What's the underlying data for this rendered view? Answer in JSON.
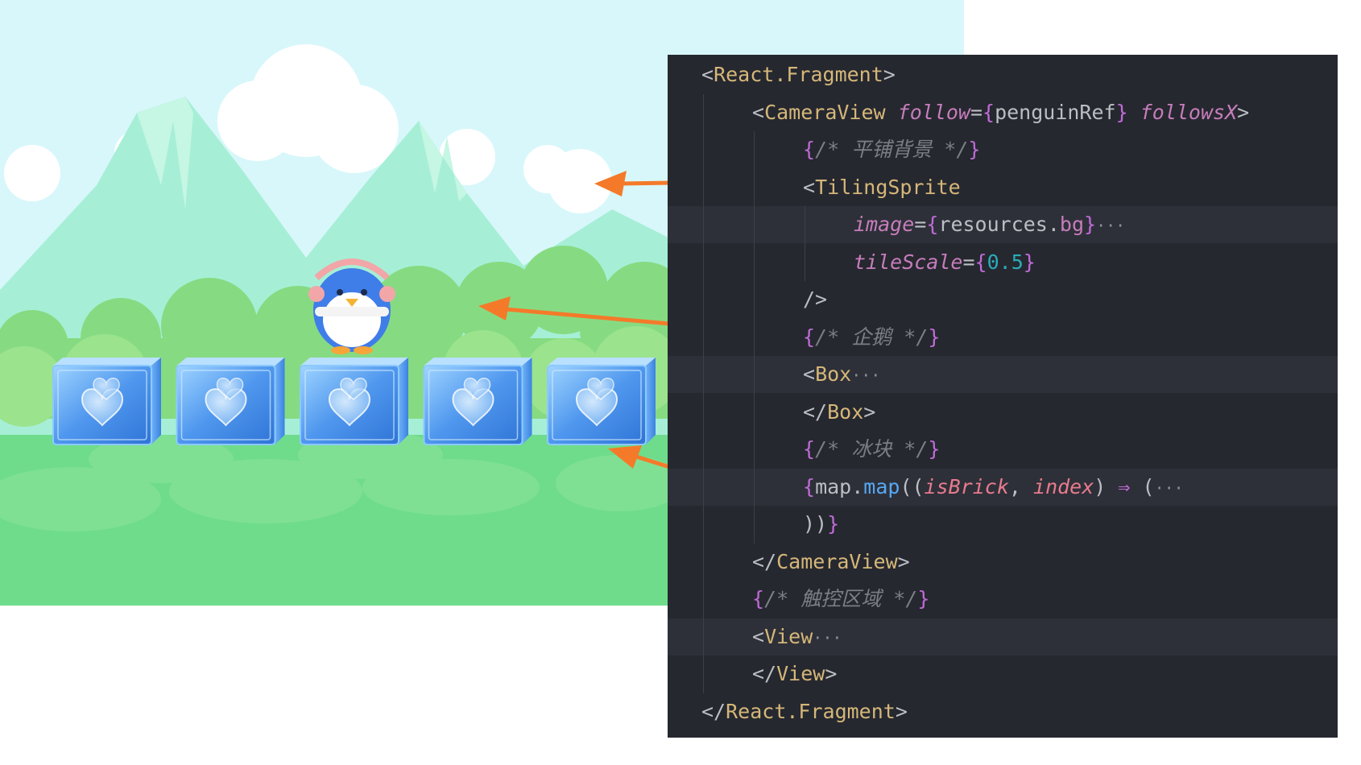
{
  "code": {
    "lines": [
      {
        "indent": 0,
        "hl": false,
        "tokens": [
          [
            "punc",
            "<"
          ],
          [
            "tag",
            "React.Fragment"
          ],
          [
            "punc",
            ">"
          ]
        ]
      },
      {
        "indent": 1,
        "hl": false,
        "tokens": [
          [
            "punc",
            "<"
          ],
          [
            "tag",
            "CameraView "
          ],
          [
            "attr",
            "follow"
          ],
          [
            "punc",
            "="
          ],
          [
            "brace",
            "{"
          ],
          [
            "ident",
            "penguinRef"
          ],
          [
            "brace",
            "}"
          ],
          [
            "punc",
            " "
          ],
          [
            "attr",
            "followsX"
          ],
          [
            "punc",
            ">"
          ]
        ]
      },
      {
        "indent": 2,
        "hl": false,
        "tokens": [
          [
            "brace",
            "{"
          ],
          [
            "comment",
            "/* 平铺背景 */"
          ],
          [
            "brace",
            "}"
          ]
        ]
      },
      {
        "indent": 2,
        "hl": false,
        "tokens": [
          [
            "punc",
            "<"
          ],
          [
            "tag",
            "TilingSprite"
          ]
        ]
      },
      {
        "indent": 3,
        "hl": true,
        "tokens": [
          [
            "attr",
            "image"
          ],
          [
            "punc",
            "="
          ],
          [
            "brace",
            "{"
          ],
          [
            "ident",
            "resources"
          ],
          [
            "punc",
            "."
          ],
          [
            "field",
            "bg"
          ],
          [
            "brace",
            "}"
          ],
          [
            "fold",
            "···"
          ]
        ]
      },
      {
        "indent": 3,
        "hl": false,
        "tokens": [
          [
            "attr",
            "tileScale"
          ],
          [
            "punc",
            "="
          ],
          [
            "brace",
            "{"
          ],
          [
            "num",
            "0.5"
          ],
          [
            "brace",
            "}"
          ]
        ]
      },
      {
        "indent": 2,
        "hl": false,
        "tokens": [
          [
            "punc",
            "/>"
          ]
        ]
      },
      {
        "indent": 2,
        "hl": false,
        "tokens": [
          [
            "brace",
            "{"
          ],
          [
            "comment",
            "/* 企鹅 */"
          ],
          [
            "brace",
            "}"
          ]
        ]
      },
      {
        "indent": 2,
        "hl": true,
        "tokens": [
          [
            "punc",
            "<"
          ],
          [
            "tag",
            "Box"
          ],
          [
            "fold",
            "···"
          ]
        ]
      },
      {
        "indent": 2,
        "hl": false,
        "tokens": [
          [
            "punc",
            "</"
          ],
          [
            "tag",
            "Box"
          ],
          [
            "punc",
            ">"
          ]
        ]
      },
      {
        "indent": 2,
        "hl": false,
        "tokens": [
          [
            "brace",
            "{"
          ],
          [
            "comment",
            "/* 冰块 */"
          ],
          [
            "brace",
            "}"
          ]
        ]
      },
      {
        "indent": 2,
        "hl": true,
        "tokens": [
          [
            "brace",
            "{"
          ],
          [
            "ident",
            "map"
          ],
          [
            "punc",
            "."
          ],
          [
            "fn",
            "map"
          ],
          [
            "punc",
            "(("
          ],
          [
            "param",
            "isBrick"
          ],
          [
            "punc",
            ", "
          ],
          [
            "param",
            "index"
          ],
          [
            "punc",
            ") "
          ],
          [
            "arrow",
            "⇒"
          ],
          [
            "punc",
            " ("
          ],
          [
            "fold",
            "···"
          ]
        ]
      },
      {
        "indent": 2,
        "hl": false,
        "tokens": [
          [
            "punc",
            "))"
          ],
          [
            "brace",
            "}"
          ]
        ]
      },
      {
        "indent": 1,
        "hl": false,
        "tokens": [
          [
            "punc",
            "</"
          ],
          [
            "tag",
            "CameraView"
          ],
          [
            "punc",
            ">"
          ]
        ]
      },
      {
        "indent": 1,
        "hl": false,
        "tokens": [
          [
            "brace",
            "{"
          ],
          [
            "comment",
            "/* 触控区域 */"
          ],
          [
            "brace",
            "}"
          ]
        ]
      },
      {
        "indent": 1,
        "hl": true,
        "tokens": [
          [
            "punc",
            "<"
          ],
          [
            "tag",
            "View"
          ],
          [
            "fold",
            "···"
          ]
        ]
      },
      {
        "indent": 1,
        "hl": false,
        "tokens": [
          [
            "punc",
            "</"
          ],
          [
            "tag",
            "View"
          ],
          [
            "punc",
            ">"
          ]
        ]
      },
      {
        "indent": 0,
        "hl": false,
        "tokens": [
          [
            "punc",
            "</"
          ],
          [
            "tag",
            "React.Fragment"
          ],
          [
            "punc",
            ">"
          ]
        ]
      }
    ]
  },
  "scene": {
    "sky_color": "#d8f7fa",
    "mountain_color": "#a6efd6",
    "ground_color": "#6edc8b",
    "bush_color": "#9be38d",
    "ice_color": "#5aa8f2",
    "arrow_color": "#f47a2a",
    "ice_block_count": 5
  }
}
